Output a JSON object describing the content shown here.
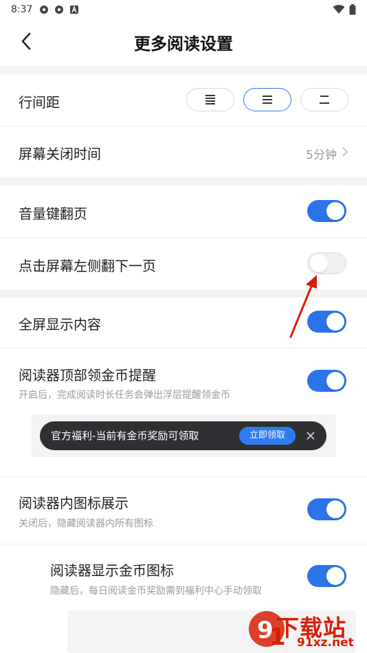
{
  "status_bar": {
    "time": "8:37",
    "left_icons": [
      "settings-cog-icon",
      "settings-cog-icon",
      "app-a-icon"
    ],
    "right_icons": [
      "wifi-icon",
      "battery-icon"
    ]
  },
  "header": {
    "title": "更多阅读设置",
    "back_icon": "chevron-left-icon"
  },
  "line_spacing": {
    "label": "行间距",
    "options": [
      {
        "icon": "spacing-tight-icon",
        "selected": false
      },
      {
        "icon": "spacing-medium-icon",
        "selected": true
      },
      {
        "icon": "spacing-wide-icon",
        "selected": false
      }
    ]
  },
  "screen_off": {
    "label": "屏幕关闭时间",
    "value": "5分钟"
  },
  "settings": {
    "volume_page": {
      "label": "音量键翻页",
      "on": true
    },
    "tap_left": {
      "label": "点击屏幕左侧翻下一页",
      "on": false
    },
    "fullscreen": {
      "label": "全屏显示内容",
      "on": true
    },
    "coin_reminder": {
      "label": "阅读器顶部领金币提醒",
      "desc": "开启后，完成阅读时长任务会弹出浮层提醒领金币",
      "on": true
    },
    "icon_display": {
      "label": "阅读器内图标展示",
      "desc": "关闭后，隐藏阅读器内所有图标",
      "on": true
    },
    "coin_icon": {
      "label": "阅读器显示金币图标",
      "desc": "隐藏后，每日阅读金币奖励需到福利中心手动领取",
      "on": true
    }
  },
  "banner": {
    "text": "官方福利-当前有金币奖励可领取",
    "button": "立即领取",
    "close_icon": "close-icon"
  },
  "watermark": {
    "text": "下载站",
    "url": "91xz.net"
  },
  "colors": {
    "accent": "#2b74e8",
    "annotation_arrow": "#d81e06"
  }
}
